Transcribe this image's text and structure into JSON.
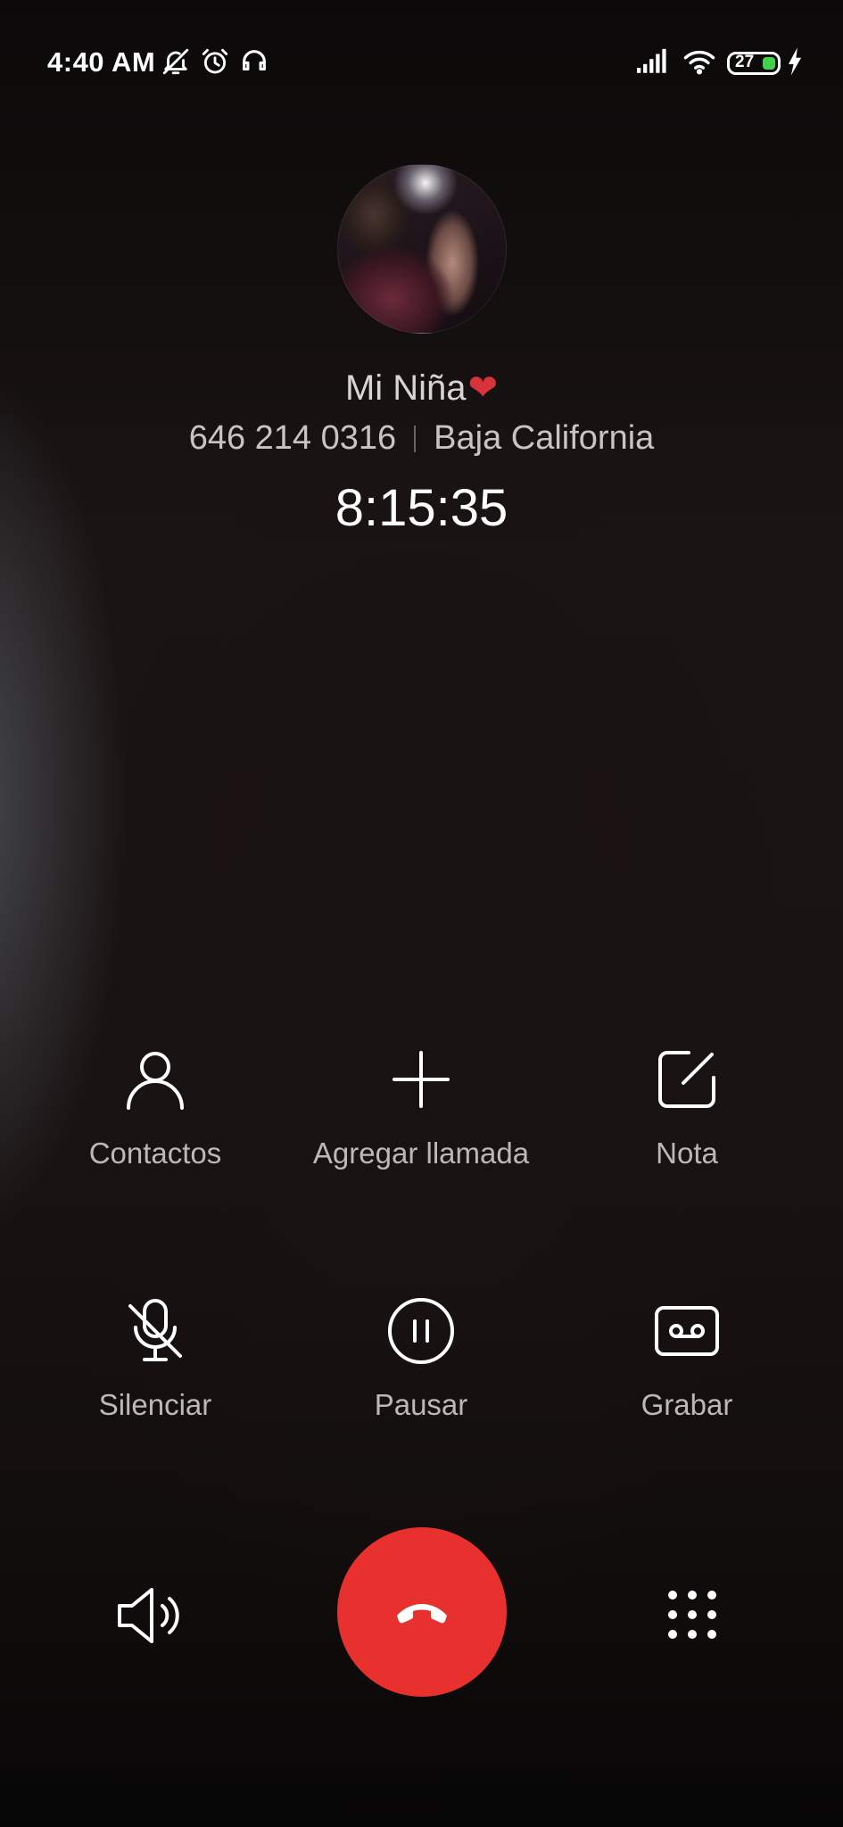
{
  "status_bar": {
    "time": "4:40 AM",
    "battery_level": "27",
    "icons": [
      "mute-notifications-icon",
      "alarm-icon",
      "headphones-icon",
      "signal-icon",
      "wifi-icon",
      "battery-icon",
      "charging-icon"
    ]
  },
  "caller": {
    "name": "Mi Niña",
    "name_emoji": "❤",
    "number": "646 214 0316",
    "location": "Baja California",
    "duration": "8:15:35"
  },
  "actions": {
    "contacts": "Contactos",
    "add_call": "Agregar llamada",
    "note": "Nota",
    "mute": "Silenciar",
    "hold": "Pausar",
    "record": "Grabar"
  },
  "colors": {
    "end_call": "#e8312f",
    "battery_fill": "#3fd24a",
    "heart": "#d8323a"
  }
}
